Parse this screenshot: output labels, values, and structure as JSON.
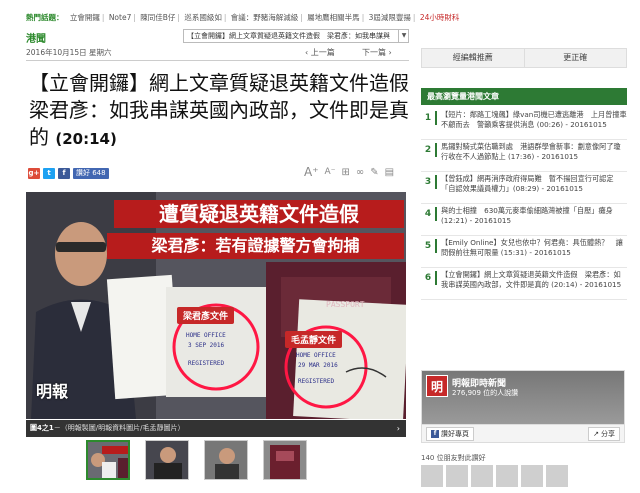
{
  "hotbar": {
    "label": "熱門話題：",
    "items": [
      "立會開鑼",
      "Note7",
      "陳同佳B仔",
      "巡系國級如",
      "會議：野豬海解減級",
      "屬地鷹相關半馬",
      "3屆減限豐揚"
    ],
    "live": "24小時財科"
  },
  "section": {
    "title": "港聞",
    "date": "2016年10月15日 星期六",
    "prev": "上一篇",
    "next": "下一篇",
    "crumb": "【立會開鑼】網上文章質疑退英籍文件造假　梁君彥：如我串謀與"
  },
  "right_tabs": [
    "經編輯推薦",
    "更正確"
  ],
  "headline": {
    "text": "【立會開鑼】網上文章質疑退英籍文件造假　梁君彥：如我串謀英國內政部，文件即是真的",
    "time": "(20:14)"
  },
  "share": {
    "like_label": "讚好 648"
  },
  "photo": {
    "banner1": "遭質疑退英籍文件造假",
    "banner2": "梁君彥：若有證據警方會拘捕",
    "label_right": "梁君彥文件",
    "label_left": "毛孟靜文件",
    "stamp1_line1": "HOME OFFICE",
    "stamp1_line2": "3 SEP 2016",
    "stamp1_line3": "REGISTERED",
    "stamp2_line1": "HOME OFFICE",
    "stamp2_line2": "29 MAR 2016",
    "stamp2_line3": "REGISTERED",
    "passport": "PASSPORT",
    "watermark": "明報"
  },
  "caption": {
    "num": "圖4之1",
    "text": "－（明報製圖/明報資料圖片/毛孟靜圖片）",
    "next": "›"
  },
  "sidebar": {
    "title": "最高瀏覽量港聞文章",
    "items": [
      {
        "num": "1",
        "text": "【短片：鄰路工塊飆】綠van司機已遭逃離港　上月曾撞車不顧而去　警籲乘客提供消息 (00:26) - 20161015"
      },
      {
        "num": "2",
        "text": "馬鑼對騎式菜估職到處　港語群學會新事：劃意像阿了瓊行收在不人過節點上 (17:36) - 20161015"
      },
      {
        "num": "3",
        "text": "【曾鈺成】網再消序政府得局難　暫不揚回宣行可認定「自認效果議員權力」(08:29) - 20161015"
      },
      {
        "num": "4",
        "text": "與的士相撞　630萬元麥車偷細路灣被撞「自壓」癱身 (12:21) - 20161015"
      },
      {
        "num": "5",
        "text": "【Emily Online】女兒也依中？何君堯：具伍體熱？　讓問假前往無可限量 (15:31) - 20161015"
      },
      {
        "num": "6",
        "text": "【立會開鑼】網上文章質疑退英籍文件造假　梁君彥：如我串謀英國內政部，文件即是真的 (20:14) - 20161015"
      }
    ]
  },
  "facebook": {
    "name": "明報即時新聞",
    "count": "276,909 位的人說讚",
    "like_btn": "讚好專頁",
    "share_btn": "分享",
    "friends": "140 位朋友對此讚好"
  }
}
